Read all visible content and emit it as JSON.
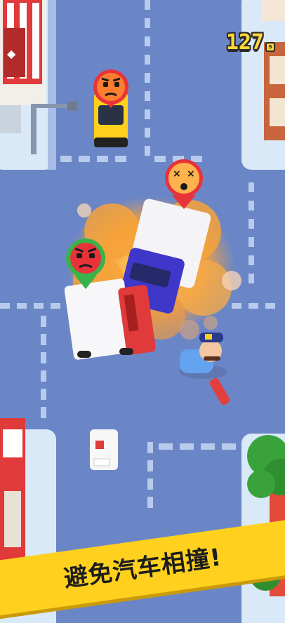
{
  "hud": {
    "timer_value": "127",
    "timer_unit": "s"
  },
  "banner": {
    "caption": "避免汽车相撞!"
  },
  "colors": {
    "road": "#6b86c6",
    "sidewalk": "#d9e9f7",
    "lane_marking": "#b8cbec",
    "banner_yellow": "#ffd11e",
    "explosion": "#f6a23a",
    "angry_emoji": "#ff6f3c",
    "furious_emoji": "#e8333a",
    "dizzy_emoji": "#ffb24d"
  },
  "scene": {
    "vehicles": [
      {
        "kind": "taxi",
        "color": "yellow"
      },
      {
        "kind": "delivery-truck",
        "color": "red"
      },
      {
        "kind": "delivery-truck",
        "color": "blue"
      },
      {
        "kind": "ice-cream-van",
        "color": "white"
      }
    ],
    "emotes": [
      {
        "target": "taxi",
        "mood": "angry",
        "pin": "red"
      },
      {
        "target": "blue-truck",
        "mood": "dizzy",
        "pin": "red"
      },
      {
        "target": "red-truck",
        "mood": "furious",
        "pin": "green"
      }
    ],
    "character": "traffic-police-officer"
  }
}
